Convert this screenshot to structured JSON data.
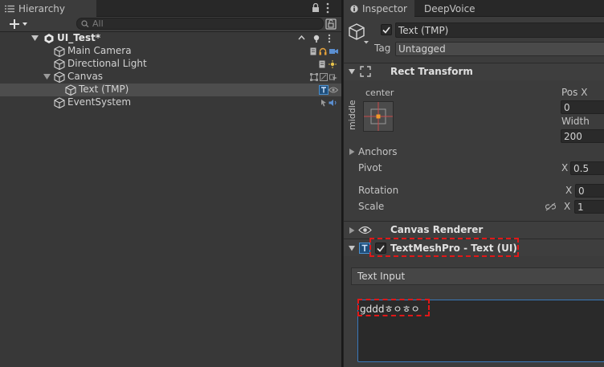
{
  "hierarchy": {
    "tab_label": "Hierarchy",
    "search_placeholder": "All",
    "scene_name": "UI_Test*",
    "items": [
      {
        "label": "Main Camera"
      },
      {
        "label": "Directional Light"
      },
      {
        "label": "Canvas"
      },
      {
        "label": "Text (TMP)"
      },
      {
        "label": "EventSystem"
      }
    ]
  },
  "inspector": {
    "tabs": [
      {
        "label": "Inspector"
      },
      {
        "label": "DeepVoice"
      }
    ],
    "object_name": "Text (TMP)",
    "tag_label": "Tag",
    "tag_value": "Untagged",
    "rect_transform": {
      "title": "Rect Transform",
      "anchor_h": "center",
      "anchor_v": "middle",
      "pos_x_label": "Pos X",
      "pos_x_value": "0",
      "width_label": "Width",
      "width_value": "200",
      "anchors_label": "Anchors",
      "pivot_label": "Pivot",
      "pivot_x_label": "X",
      "pivot_x_value": "0.5",
      "rotation_label": "Rotation",
      "rotation_x_label": "X",
      "rotation_x_value": "0",
      "scale_label": "Scale",
      "scale_x_label": "X",
      "scale_x_value": "1"
    },
    "canvas_renderer": {
      "title": "Canvas Renderer"
    },
    "textmeshpro": {
      "title": "TextMeshPro - Text (UI)",
      "text_input_label": "Text Input",
      "text_value": "gdddㅎㅇㅎㅇ"
    }
  },
  "colors": {
    "highlight_red": "#e01818",
    "selection_blue": "#3a79bb",
    "anchor_orange": "#f09a2a"
  }
}
